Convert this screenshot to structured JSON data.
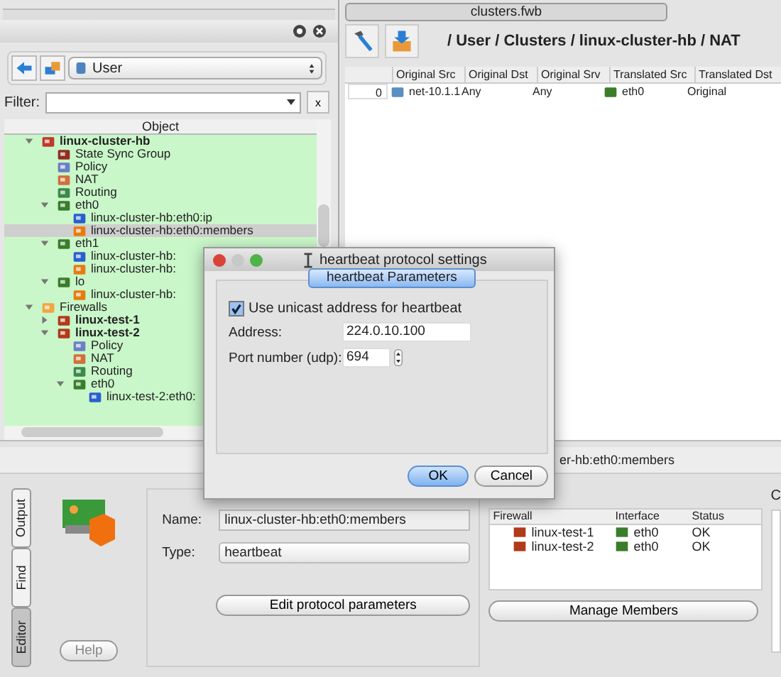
{
  "left_panel": {
    "source_select": "User",
    "filter_label": "Filter:",
    "filter_clear": "x",
    "tree_header": "Object",
    "tree": [
      {
        "label": "linux-cluster-hb",
        "kind": "cluster",
        "expanded": true,
        "selected": false,
        "children": [
          {
            "label": "State Sync Group",
            "kind": "group",
            "selected": false
          },
          {
            "label": "Policy",
            "kind": "policy",
            "selected": false
          },
          {
            "label": "NAT",
            "kind": "nat",
            "selected": false
          },
          {
            "label": "Routing",
            "kind": "routing",
            "selected": false
          },
          {
            "label": "eth0",
            "kind": "interface",
            "expanded": true,
            "selected": false,
            "children": [
              {
                "label": "linux-cluster-hb:eth0:ip",
                "kind": "address",
                "selected": false
              },
              {
                "label": "linux-cluster-hb:eth0:members",
                "kind": "member",
                "selected": true
              }
            ]
          },
          {
            "label": "eth1",
            "kind": "interface",
            "expanded": true,
            "selected": false,
            "children": [
              {
                "label": "linux-cluster-hb:",
                "kind": "address",
                "selected": false
              },
              {
                "label": "linux-cluster-hb:",
                "kind": "member",
                "selected": false
              }
            ]
          },
          {
            "label": "lo",
            "kind": "interface",
            "expanded": true,
            "selected": false,
            "children": [
              {
                "label": "linux-cluster-hb:",
                "kind": "member",
                "selected": false
              }
            ]
          }
        ]
      },
      {
        "label": "Firewalls",
        "kind": "folder",
        "expanded": true,
        "selected": false,
        "children": [
          {
            "label": "linux-test-1",
            "kind": "firewall",
            "expanded": false,
            "selected": false
          },
          {
            "label": "linux-test-2",
            "kind": "firewall",
            "expanded": true,
            "selected": false,
            "children": [
              {
                "label": "Policy",
                "kind": "policy",
                "selected": false
              },
              {
                "label": "NAT",
                "kind": "nat",
                "selected": false
              },
              {
                "label": "Routing",
                "kind": "routing",
                "selected": false
              },
              {
                "label": "eth0",
                "kind": "interface",
                "expanded": true,
                "selected": false,
                "children": [
                  {
                    "label": "linux-test-2:eth0:",
                    "kind": "address",
                    "selected": false
                  }
                ]
              }
            ]
          }
        ]
      }
    ]
  },
  "document_tab": "clusters.fwb",
  "path": "/ User / Clusters / linux-cluster-hb / NAT",
  "rules_table": {
    "columns": [
      "Original Src",
      "Original Dst",
      "Original Srv",
      "Translated Src",
      "Translated Dst"
    ],
    "rows": [
      {
        "number": "0",
        "cells": [
          {
            "text": "net-10.1.1",
            "kind": "network"
          },
          {
            "text": "Any",
            "kind": "text"
          },
          {
            "text": "Any",
            "kind": "text"
          },
          {
            "text": "eth0",
            "kind": "interface"
          },
          {
            "text": "Original",
            "kind": "text"
          }
        ]
      }
    ]
  },
  "editor": {
    "header_text": "er-hb:eth0:members",
    "side_tabs": [
      {
        "label": "Output",
        "selected": false
      },
      {
        "label": "Find",
        "selected": false
      },
      {
        "label": "Editor",
        "selected": true
      }
    ],
    "help_button": "Help",
    "name_label": "Name:",
    "name_value": "linux-cluster-hb:eth0:members",
    "type_label": "Type:",
    "type_value": "heartbeat",
    "edit_button": "Edit protocol parameters",
    "members": {
      "columns": [
        "Firewall",
        "Interface",
        "Status"
      ],
      "rows": [
        {
          "firewall": "linux-test-1",
          "interface": "eth0",
          "status": "OK"
        },
        {
          "firewall": "linux-test-2",
          "interface": "eth0",
          "status": "OK"
        }
      ]
    },
    "manage_button": "Manage Members",
    "column_4_label": "C"
  },
  "dialog": {
    "title": "heartbeat protocol settings",
    "group_tab": "heartbeat Parameters",
    "unicast": {
      "label": "Use unicast address for heartbeat",
      "checked": true
    },
    "address_label": "Address:",
    "address_value": "224.0.10.100",
    "port_label": "Port number (udp):",
    "port_value": "694",
    "ok_button": "OK",
    "cancel_button": "Cancel"
  }
}
